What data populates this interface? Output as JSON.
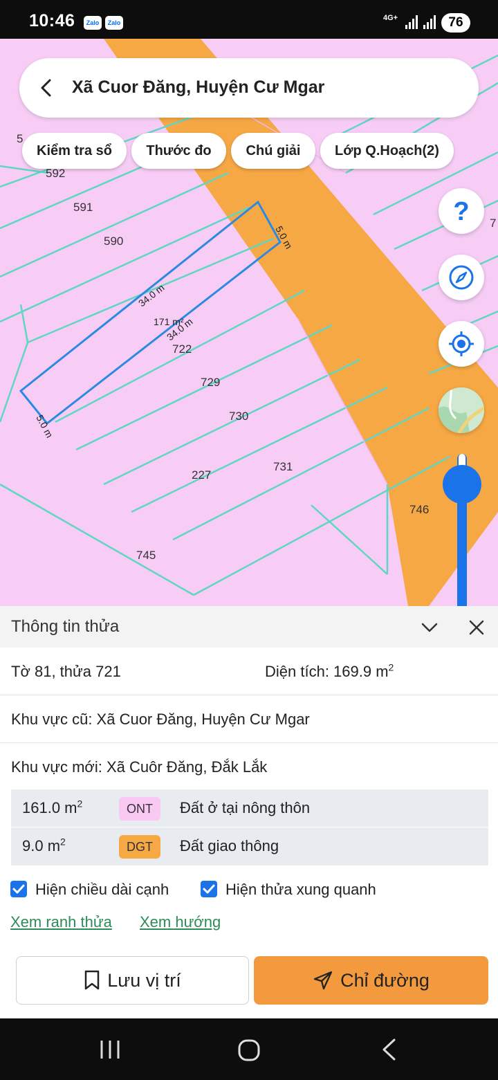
{
  "status_bar": {
    "time": "10:46",
    "notifications": [
      "Zalo",
      "Zalo"
    ],
    "network": "4G+",
    "battery": "76"
  },
  "search": {
    "title": "Xã Cuor Đăng, Huyện Cư Mgar"
  },
  "chips": [
    {
      "label": "Kiểm tra sổ"
    },
    {
      "label": "Thước đo"
    },
    {
      "label": "Chú giải"
    },
    {
      "label": "Lớp Q.Hoạch(2)"
    }
  ],
  "map": {
    "parcel_numbers": [
      "592",
      "591",
      "590",
      "722",
      "729",
      "730",
      "731",
      "227",
      "746",
      "745"
    ],
    "partial_labels": [
      "5",
      "7"
    ],
    "selected_parcel": {
      "area_label": "171 m²",
      "edge_labels": [
        "34.0 m",
        "34.0 m",
        "5.0 m",
        "5.0 m"
      ]
    },
    "colors": {
      "residential": "#f7cdf6",
      "road": "#f6a845",
      "parcel_line": "#5fd6c4",
      "selection": "#2b8ae0"
    }
  },
  "side_buttons": {
    "help_icon": "question-icon",
    "compass_icon": "compass-icon",
    "locate_icon": "gps-target-icon",
    "layer_icon": "map-layer-thumbnail"
  },
  "panel": {
    "title": "Thông tin thửa",
    "parcel_id": "Tờ 81, thửa 721",
    "area_label": "Diện tích: 169.9 m",
    "area_sup": "2",
    "old_area": "Khu vực cũ: Xã Cuor Đăng, Huyện Cư Mgar",
    "new_area": "Khu vực mới: Xã Cuôr Đăng, Đắk Lắk",
    "land_use": [
      {
        "area": "161.0 m",
        "sup": "2",
        "code": "ONT",
        "name": "Đất ở tại nông thôn",
        "color": "#f9c9f3"
      },
      {
        "area": "9.0 m",
        "sup": "2",
        "code": "DGT",
        "name": "Đất giao thông",
        "color": "#f6a845"
      }
    ],
    "checkboxes": [
      {
        "label": "Hiện chiều dài cạnh",
        "checked": true
      },
      {
        "label": "Hiện thửa xung quanh",
        "checked": true
      }
    ],
    "links": [
      "Xem ranh thửa",
      "Xem hướng"
    ],
    "save_label": "Lưu vị trí",
    "directions_label": "Chỉ đường"
  }
}
